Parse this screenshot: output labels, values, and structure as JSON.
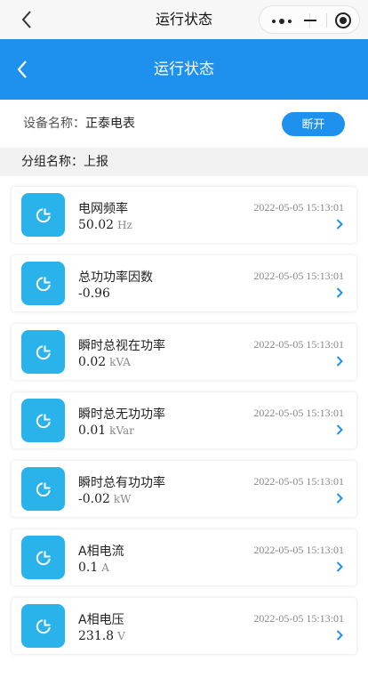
{
  "wx_nav": {
    "title": "运行状态"
  },
  "header": {
    "title": "运行状态"
  },
  "device": {
    "label": "设备名称：",
    "name": "正泰电表",
    "disconnect_label": "断开"
  },
  "group": {
    "label": "分组名称：",
    "name": "上报"
  },
  "colors": {
    "brand_blue": "#1e90ee",
    "icon_blue": "#2ab2ea"
  },
  "items": [
    {
      "name": "电网频率",
      "value": "50.02",
      "unit": "Hz",
      "time": "2022-05-05 15:13:01",
      "icon": "pie-chart-icon"
    },
    {
      "name": "总功功率因数",
      "value": "-0.96",
      "unit": "",
      "time": "2022-05-05 15:13:01",
      "icon": "pie-chart-icon"
    },
    {
      "name": "瞬时总视在功率",
      "value": "0.02",
      "unit": "kVA",
      "time": "2022-05-05 15:13:01",
      "icon": "pie-chart-icon"
    },
    {
      "name": "瞬时总无功功率",
      "value": "0.01",
      "unit": "kVar",
      "time": "2022-05-05 15:13:01",
      "icon": "pie-chart-icon"
    },
    {
      "name": "瞬时总有功功率",
      "value": "-0.02",
      "unit": "kW",
      "time": "2022-05-05 15:13:01",
      "icon": "pie-chart-icon"
    },
    {
      "name": "A相电流",
      "value": "0.1",
      "unit": "A",
      "time": "2022-05-05 15:13:01",
      "icon": "pie-chart-icon"
    },
    {
      "name": "A相电压",
      "value": "231.8",
      "unit": "V",
      "time": "2022-05-05 15:13:01",
      "icon": "pie-chart-icon"
    }
  ]
}
